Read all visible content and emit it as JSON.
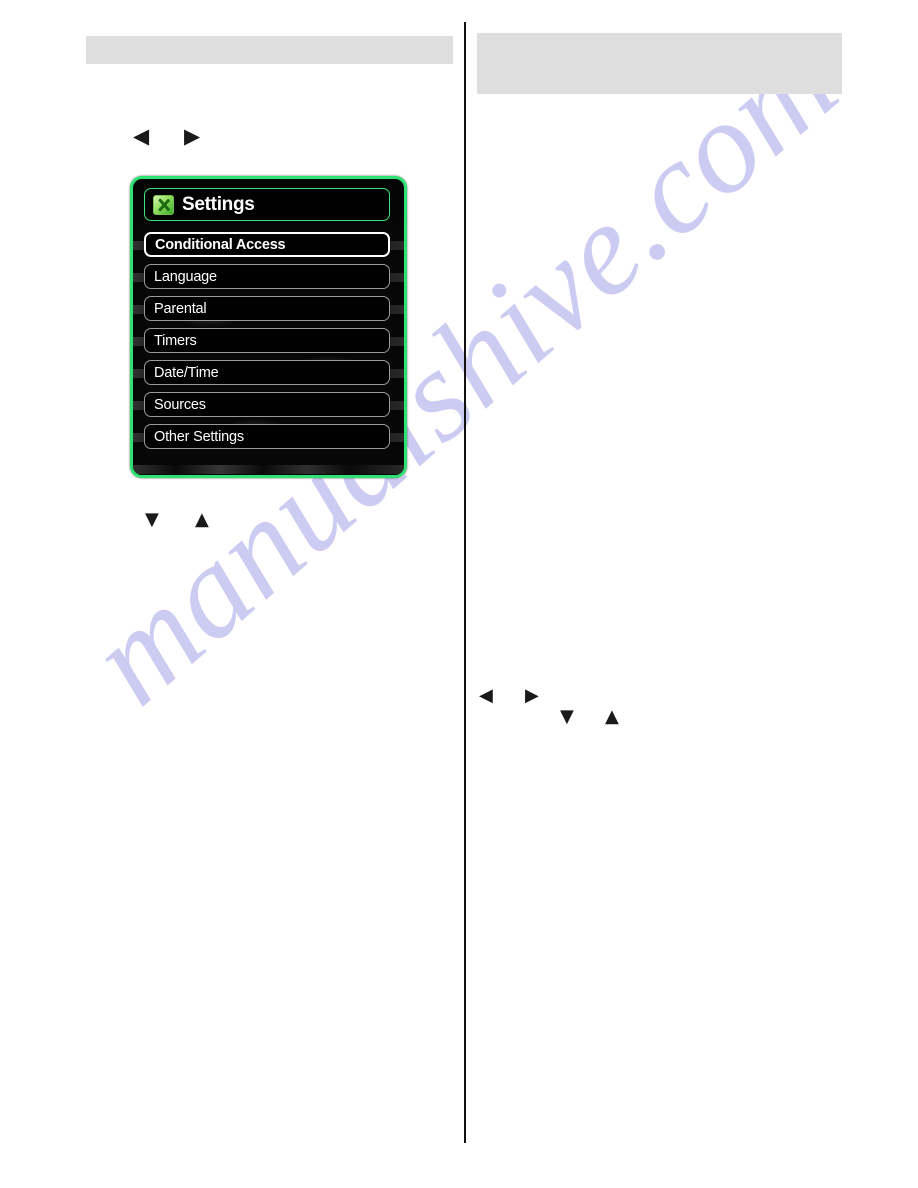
{
  "page": {
    "watermark": "manualshive.com",
    "background_color": "#ffffff",
    "divider_color": "#111111"
  },
  "left_column": {
    "header_bar": {
      "label": "",
      "color": "#dededf"
    },
    "nav_hints_top": [
      {
        "name": "left-arrow",
        "glyph": "◀"
      },
      {
        "name": "right-arrow",
        "glyph": "▶"
      }
    ],
    "nav_hints_below_figure": [
      {
        "name": "down-arrow",
        "glyph": "▼"
      },
      {
        "name": "up-arrow",
        "glyph": "▲"
      }
    ],
    "figure": {
      "name": "tv-settings-menu-screenshot",
      "title": "Settings",
      "icon": "settings-tools-icon",
      "border_color": "#2ce272",
      "background_color": "#050505",
      "menu_items": [
        {
          "label": "Conditional Access",
          "selected": true
        },
        {
          "label": "Language",
          "selected": false
        },
        {
          "label": "Parental",
          "selected": false
        },
        {
          "label": "Timers",
          "selected": false
        },
        {
          "label": "Date/Time",
          "selected": false
        },
        {
          "label": "Sources",
          "selected": false
        },
        {
          "label": "Other Settings",
          "selected": false
        }
      ]
    }
  },
  "right_column": {
    "header_bar": {
      "label": "",
      "color": "#dededf"
    },
    "nav_hints": [
      {
        "name": "left-arrow",
        "glyph": "◀"
      },
      {
        "name": "right-arrow",
        "glyph": "▶"
      },
      {
        "name": "down-arrow",
        "glyph": "▼"
      },
      {
        "name": "up-arrow",
        "glyph": "▲"
      }
    ]
  }
}
